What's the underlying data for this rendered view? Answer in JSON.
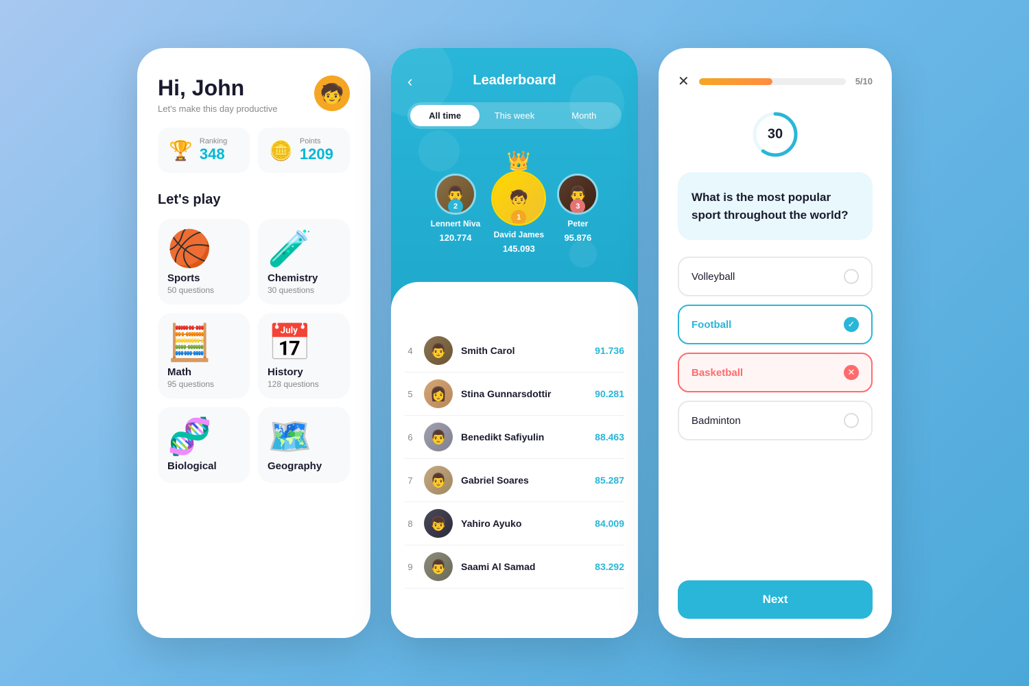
{
  "home": {
    "greeting": "Hi, John",
    "subtitle": "Let's make this day productive",
    "avatar_emoji": "🧒",
    "stats": {
      "ranking_label": "Ranking",
      "ranking_value": "348",
      "points_label": "Points",
      "points_value": "1209"
    },
    "section_title": "Let's play",
    "subjects": [
      {
        "name": "Sports",
        "questions": "50 questions",
        "icon": "🏀"
      },
      {
        "name": "Chemistry",
        "questions": "30 questions",
        "icon": "🧪"
      },
      {
        "name": "Math",
        "questions": "95 questions",
        "icon": "🧮"
      },
      {
        "name": "History",
        "questions": "128 questions",
        "icon": "📅"
      },
      {
        "name": "Biological",
        "questions": "",
        "icon": "🧬"
      },
      {
        "name": "Geography",
        "questions": "",
        "icon": "🗺️"
      }
    ]
  },
  "leaderboard": {
    "back_icon": "‹",
    "title": "Leaderboard",
    "tabs": [
      {
        "label": "All time",
        "active": true
      },
      {
        "label": "This week",
        "active": false
      },
      {
        "label": "Month",
        "active": false
      }
    ],
    "podium": [
      {
        "rank": 2,
        "name": "Lennert Niva",
        "score": "120.774",
        "rank_class": "rank-2"
      },
      {
        "rank": 1,
        "name": "David James",
        "score": "145.093",
        "rank_class": "rank-1",
        "crown": "👑"
      },
      {
        "rank": 3,
        "name": "Peter",
        "score": "95.876",
        "rank_class": "rank-3"
      }
    ],
    "list": [
      {
        "rank": 4,
        "name": "Smith Carol",
        "score": "91.736",
        "person_class": "person-4"
      },
      {
        "rank": 5,
        "name": "Stina Gunnarsdottir",
        "score": "90.281",
        "person_class": "person-5"
      },
      {
        "rank": 6,
        "name": "Benedikt Safiyulin",
        "score": "88.463",
        "person_class": "person-6"
      },
      {
        "rank": 7,
        "name": "Gabriel Soares",
        "score": "85.287",
        "person_class": "person-7"
      },
      {
        "rank": 8,
        "name": "Yahiro Ayuko",
        "score": "84.009",
        "person_class": "person-8"
      },
      {
        "rank": 9,
        "name": "Saami Al Samad",
        "score": "83.292",
        "person_class": "person-9"
      }
    ]
  },
  "quiz": {
    "close_icon": "✕",
    "progress_current": 5,
    "progress_total": 10,
    "progress_percent": 50,
    "timer_value": 30,
    "timer_percent": 60,
    "question": "What is the most popular sport throughout the world?",
    "answers": [
      {
        "text": "Volleyball",
        "state": "neutral"
      },
      {
        "text": "Football",
        "state": "correct"
      },
      {
        "text": "Basketball",
        "state": "wrong"
      },
      {
        "text": "Badminton",
        "state": "neutral"
      }
    ],
    "next_button_label": "Next"
  }
}
